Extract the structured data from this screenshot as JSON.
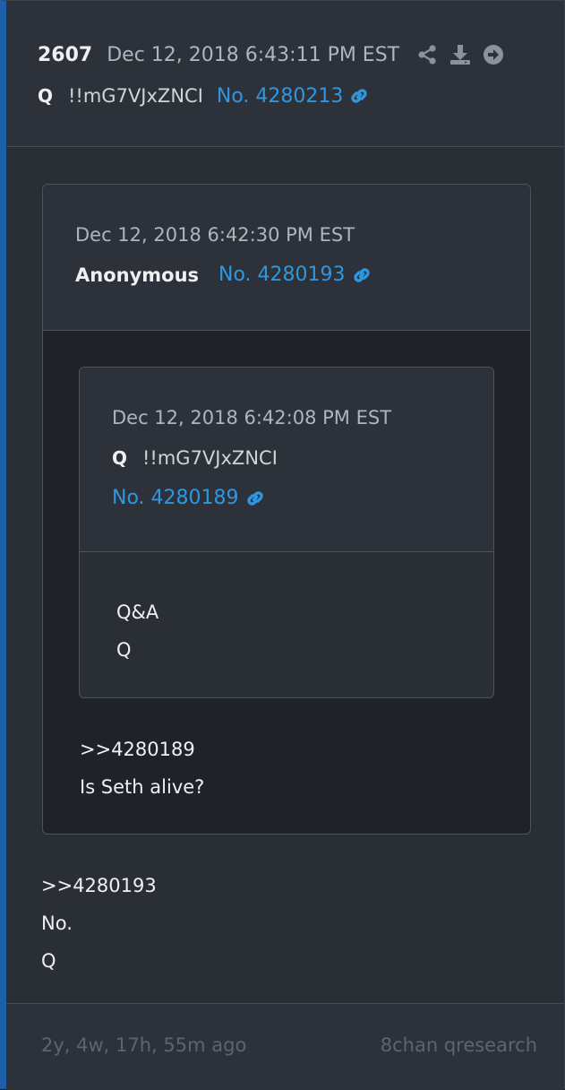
{
  "post": {
    "number": "2607",
    "date": "Dec 12, 2018 6:43:11 PM EST",
    "author": "Q",
    "tripcode": "!!mG7VJxZNCI",
    "post_no": "No. 4280213",
    "body_lines": [
      ">>4280193",
      "No.",
      "Q"
    ],
    "icons": [
      "share-icon",
      "download-icon",
      "arrow-right-circle-icon",
      "link-icon"
    ]
  },
  "quoted": {
    "date": "Dec 12, 2018 6:42:30 PM EST",
    "author": "Anonymous",
    "post_no": "No. 4280193",
    "body_lines": [
      ">>4280189",
      "Is Seth alive?"
    ],
    "nested": {
      "date": "Dec 12, 2018 6:42:08 PM EST",
      "author": "Q",
      "tripcode": "!!mG7VJxZNCI",
      "post_no": "No. 4280189",
      "body_lines": [
        "Q&A",
        "Q"
      ]
    }
  },
  "footer": {
    "ago": "2y, 4w, 17h, 55m ago",
    "source": "8chan qresearch"
  },
  "colors": {
    "accent_border": "#1d5fa8",
    "link": "#2f96e0",
    "muted": "#5c656f"
  }
}
